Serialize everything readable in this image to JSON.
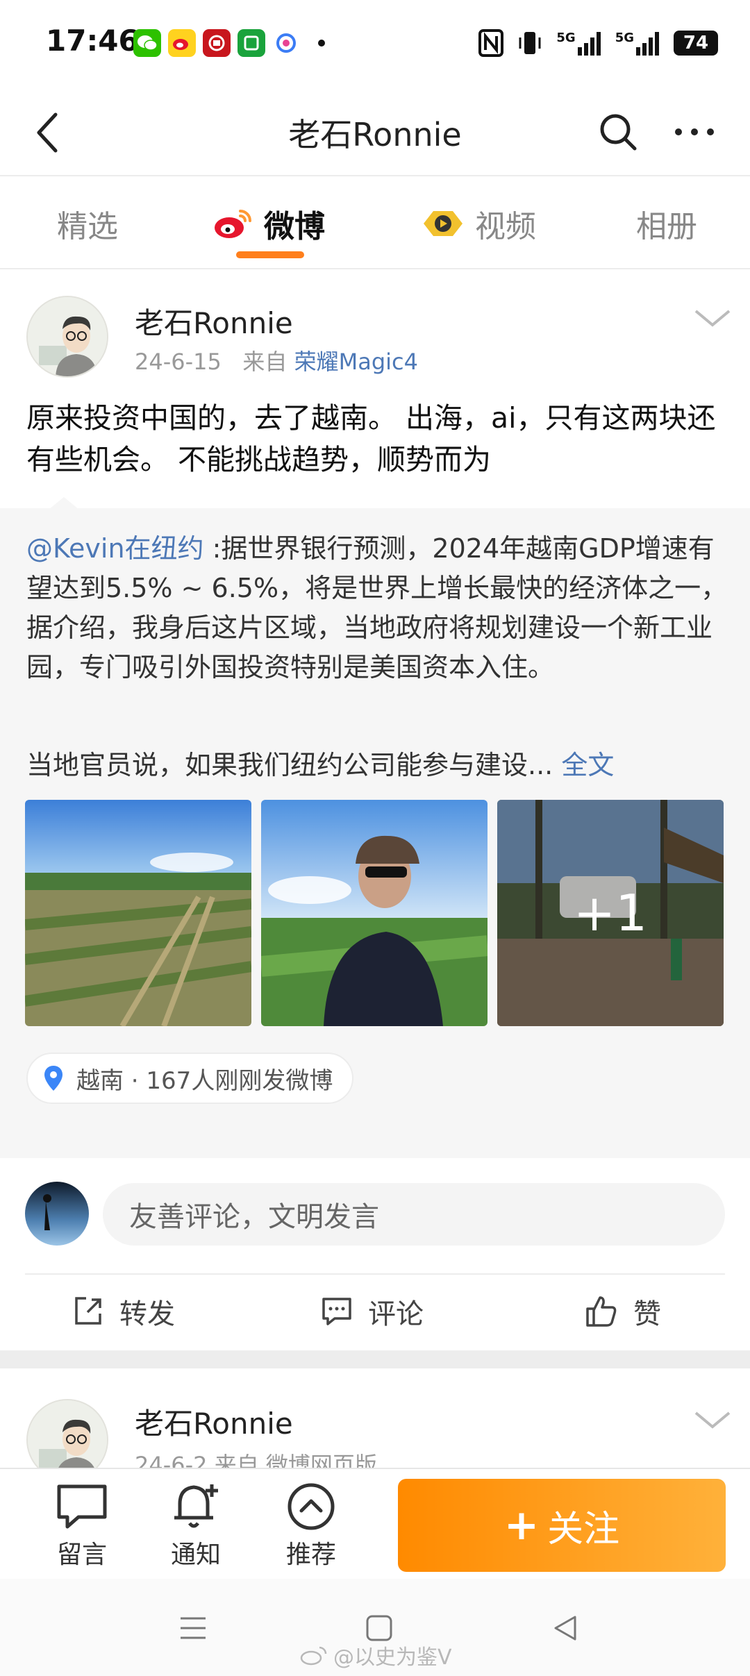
{
  "status_bar": {
    "time": "17:46",
    "signal_1": "5G",
    "signal_2": "5G",
    "battery": "74"
  },
  "header": {
    "title": "老石Ronnie"
  },
  "tabs": [
    {
      "label": "精选"
    },
    {
      "label": "微博"
    },
    {
      "label": "视频"
    },
    {
      "label": "相册"
    }
  ],
  "active_tab": "微博",
  "post": {
    "author": "老石Ronnie",
    "date": "24-6-15",
    "source_prefix": "来自",
    "device": "荣耀Magic4",
    "text": "原来投资中国的，去了越南。 出海，ai，只有这两块还有些机会。 不能挑战趋势，顺势而为",
    "repost": {
      "mention": "@Kevin在纽约",
      "text": " :据世界银行预测，2024年越南GDP增速有望达到5.5% ~ 6.5%，将是世界上增长最快的经济体之一，据介绍，我身后这片区域，当地政府将规划建设一个新工业园，专门吸引外国投资特别是美国资本入住。",
      "text2": "当地官员说，如果我们纽约公司能参与建设...",
      "full_link": "全文",
      "extra_photos": "+1",
      "location": "越南 · 167人刚刚发微博"
    },
    "comment_placeholder": "友善评论，文明发言",
    "actions": {
      "repost": "转发",
      "comment": "评论",
      "like": "赞"
    }
  },
  "post2": {
    "author": "老石Ronnie",
    "meta": "24-6-2  来自 微博网页版"
  },
  "bottom_bar": {
    "message": "留言",
    "notify": "通知",
    "recommend": "推荐",
    "follow": "关注"
  },
  "watermark": "@以史为鉴V",
  "colors": {
    "accent": "#ff7f1c",
    "link": "#4d78b6",
    "follow_gradient_start": "#ff8a00",
    "follow_gradient_end": "#ffb13a"
  }
}
